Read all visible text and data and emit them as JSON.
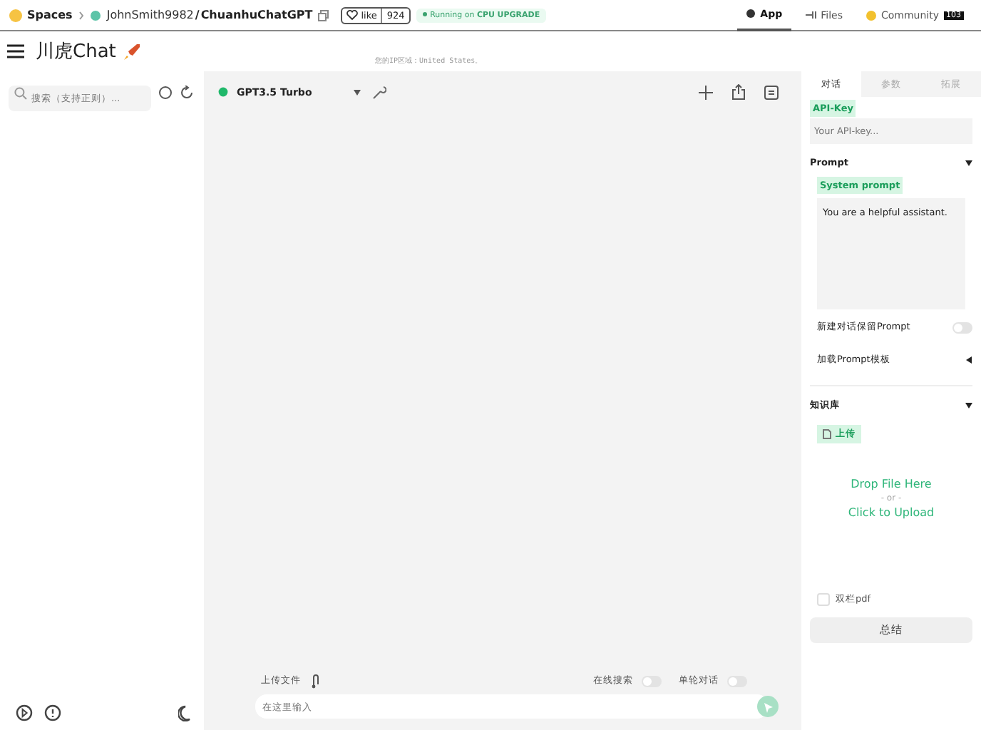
{
  "topbar": {
    "spaces": "Spaces",
    "owner": "JohnSmith9982",
    "separator": "/",
    "repo": "ChuanhuChatGPT",
    "like": "like",
    "like_count": "924",
    "status": "Running on",
    "hardware": "CPU",
    "upgrade": "UPGRADE",
    "nav": [
      {
        "label": "App",
        "selected": true
      },
      {
        "label": "Files",
        "selected": false
      },
      {
        "label": "Community",
        "selected": false,
        "badge": "103"
      }
    ]
  },
  "header": {
    "title": "川虎Chat",
    "ip": "您的IP区域：United States。"
  },
  "sidebar": {
    "search": {
      "placeholder": "搜索（支持正则）..."
    }
  },
  "chat": {
    "model": "GPT3.5 Turbo",
    "model_online": true,
    "upload_label": "上传文件",
    "toggles": [
      {
        "label": "在线搜索",
        "on": false
      },
      {
        "label": "单轮对话",
        "on": false
      }
    ],
    "input": {
      "placeholder": "在这里输入"
    }
  },
  "panel": {
    "tabs": [
      {
        "label": "对话",
        "selected": true
      },
      {
        "label": "参数",
        "selected": false
      },
      {
        "label": "拓展",
        "selected": false
      }
    ],
    "api_key_label": "API-Key",
    "api_key": {
      "placeholder": "Your API-key..."
    },
    "prompt_section": "Prompt",
    "prompt_expanded": true,
    "system_prompt_label": "System prompt",
    "system_prompt": "You are a helpful assistant.",
    "keep_prompt": {
      "label": "新建对话保留Prompt",
      "on": false
    },
    "template": {
      "label": "加载Prompt模板",
      "expanded": false
    },
    "kb_section": "知识库",
    "kb_expanded": true,
    "upload_tab": "上传",
    "drop": [
      "Drop File Here",
      "- or -",
      "Click to Upload"
    ],
    "two_column": {
      "label": "双栏pdf",
      "checked": false
    },
    "summarize": "总结"
  }
}
